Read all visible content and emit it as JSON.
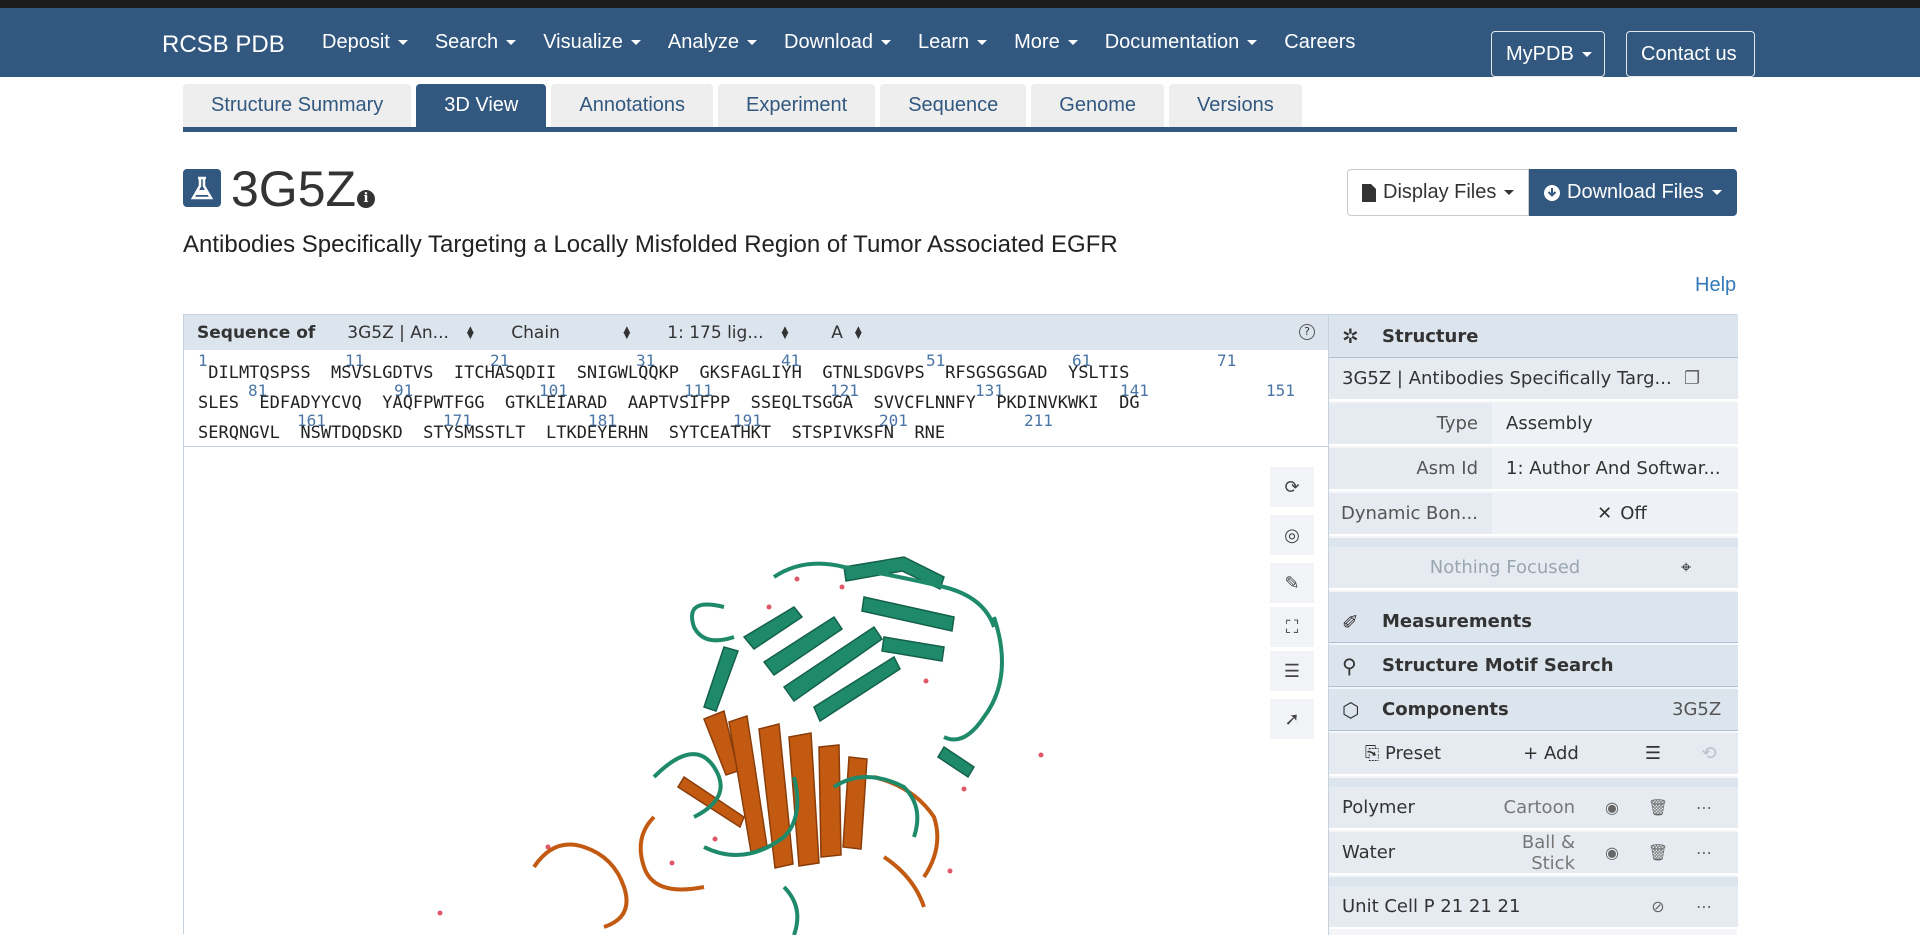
{
  "brand": "RCSB PDB",
  "nav": [
    "Deposit",
    "Search",
    "Visualize",
    "Analyze",
    "Download",
    "Learn",
    "More",
    "Documentation",
    "Careers"
  ],
  "nav_buttons": {
    "mypdb": "MyPDB",
    "contact": "Contact us"
  },
  "tabs": [
    "Structure Summary",
    "3D View",
    "Annotations",
    "Experiment",
    "Sequence",
    "Genome",
    "Versions"
  ],
  "entry": {
    "id": "3G5Z",
    "title": "Antibodies Specifically Targeting a Locally Misfolded Region of Tumor Associated EGFR"
  },
  "buttons": {
    "display_files": "Display Files",
    "download_files": "Download Files",
    "help": "Help"
  },
  "sequence_panel": {
    "label": "Sequence of",
    "entity": "3G5Z | An...",
    "mode": "Chain",
    "assembly": "1: 175 lig...",
    "chain": "A",
    "lines": [
      " DILMTQSPSS  MSVSLGDTVS  ITCHASQDII  SNIGWLQQKP  GKSFAGLIYH  GTNLSDGVPS  RFSGSGSGAD  YSLTIS",
      "SLES  EDFADYYCVQ  YAQFPWTFGG  GTKLEIARAD  AAPTVSIFPP  SSEQLTSGGA  SVVCFLNNFY  PKDINVKWKI  DG",
      "SERQNGVL  NSWTDQDSKD  STYSMSSTLT  LTKDEYERHN  SYTCEATHKT  STSPIVKSFN  RNE"
    ],
    "numbers_row1": [
      "1",
      "11",
      "21",
      "31",
      "41",
      "51",
      "61",
      "71"
    ],
    "numbers_row2": [
      "81",
      "91",
      "101",
      "111",
      "121",
      "131",
      "141",
      "151"
    ],
    "numbers_row3": [
      "161",
      "171",
      "181",
      "191",
      "201",
      "211"
    ]
  },
  "structure_panel": {
    "structure_heading": "Structure",
    "structure_name": "3G5Z | Antibodies Specifically Targ...",
    "type_key": "Type",
    "type_val": "Assembly",
    "asm_key": "Asm Id",
    "asm_val": "1: Author And Softwar...",
    "dyn_key": "Dynamic Bon...",
    "dyn_val": "Off",
    "focus": "Nothing Focused",
    "measurements": "Measurements",
    "motif": "Structure Motif Search",
    "components": "Components",
    "components_id": "3G5Z",
    "preset": "Preset",
    "add": "Add",
    "polymer": "Polymer",
    "polymer_rep": "Cartoon",
    "water": "Water",
    "water_rep": "Ball & Stick",
    "unitcell": "Unit Cell P 21 21 21"
  },
  "colors": {
    "navbar": "#325880",
    "chain_green": "#1f8a6a",
    "chain_orange": "#c25a12"
  },
  "icons": [
    "flask-icon",
    "info-icon",
    "file-icon",
    "download-circle-icon",
    "help-circle-icon",
    "reset-icon",
    "screenshot-icon",
    "wrench-icon",
    "expand-icon",
    "sliders-icon",
    "pointer-icon",
    "structure-icon",
    "copy-icon",
    "close-icon",
    "focus-icon",
    "ruler-icon",
    "search-icon",
    "cube-icon",
    "bookmark-icon",
    "plus-icon",
    "history-icon",
    "eye-icon",
    "trash-icon",
    "more-icon"
  ]
}
